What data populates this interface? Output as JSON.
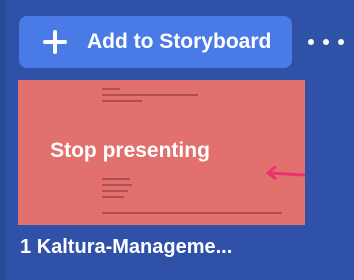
{
  "toolbar": {
    "add_label": "Add to Storyboard",
    "add_icon": "plus-icon",
    "more_icon": "more-horizontal-icon"
  },
  "thumbnail": {
    "overlay_text": "Stop presenting",
    "background_color": "#e1706e",
    "arrow_color": "#e8336e"
  },
  "slide": {
    "number": "1",
    "title": "Kaltura-Manageme..."
  }
}
